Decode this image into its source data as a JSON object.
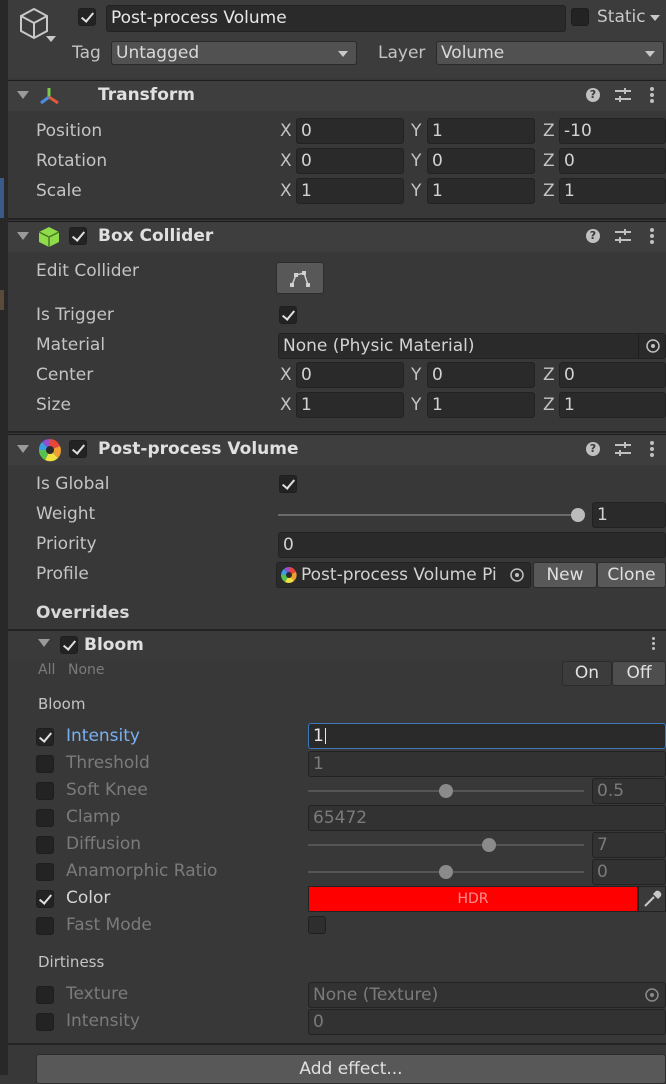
{
  "header": {
    "object_name": "Post-process Volume",
    "static_label": "Static",
    "tag_label": "Tag",
    "tag_value": "Untagged",
    "layer_label": "Layer",
    "layer_value": "Volume",
    "active": true
  },
  "transform": {
    "title": "Transform",
    "rows": [
      {
        "label": "Position",
        "x": "0",
        "y": "1",
        "z": "-10"
      },
      {
        "label": "Rotation",
        "x": "0",
        "y": "0",
        "z": "0"
      },
      {
        "label": "Scale",
        "x": "1",
        "y": "1",
        "z": "1"
      }
    ]
  },
  "axes": {
    "x": "X",
    "y": "Y",
    "z": "Z"
  },
  "box_collider": {
    "title": "Box Collider",
    "edit_collider_label": "Edit Collider",
    "is_trigger_label": "Is Trigger",
    "is_trigger": true,
    "material_label": "Material",
    "material_value": "None (Physic Material)",
    "center": {
      "label": "Center",
      "x": "0",
      "y": "0",
      "z": "0"
    },
    "size": {
      "label": "Size",
      "x": "1",
      "y": "1",
      "z": "1"
    }
  },
  "ppv": {
    "title": "Post-process Volume",
    "is_global_label": "Is Global",
    "is_global": true,
    "weight_label": "Weight",
    "weight_value": "1",
    "weight_fraction": 1.0,
    "priority_label": "Priority",
    "priority_value": "0",
    "profile_label": "Profile",
    "profile_value": "Post-process Volume Pi",
    "new_label": "New",
    "clone_label": "Clone",
    "overrides_label": "Overrides"
  },
  "bloom": {
    "title": "Bloom",
    "all_label": "All",
    "none_label": "None",
    "on_label": "On",
    "off_label": "Off",
    "section_bloom": "Bloom",
    "intensity_label": "Intensity",
    "intensity_value": "1",
    "threshold_label": "Threshold",
    "threshold_value": "1",
    "soft_knee_label": "Soft Knee",
    "soft_knee_value": "0.5",
    "soft_knee_fraction": 0.5,
    "clamp_label": "Clamp",
    "clamp_value": "65472",
    "diffusion_label": "Diffusion",
    "diffusion_value": "7",
    "diffusion_fraction": 0.655,
    "anamorphic_label": "Anamorphic Ratio",
    "anamorphic_value": "0",
    "anamorphic_fraction": 0.5,
    "color_label": "Color",
    "color_value": "#ff0000",
    "hdr_label": "HDR",
    "fast_mode_label": "Fast Mode",
    "section_dirtiness": "Dirtiness",
    "texture_label": "Texture",
    "texture_value": "None (Texture)",
    "dirt_intensity_label": "Intensity",
    "dirt_intensity_value": "0"
  },
  "add_effect_label": "Add effect...",
  "colors": {
    "accent_blue": "#7bb0f0",
    "panel": "#383838",
    "field": "#2a2a2a",
    "collider_green": "#8fdc4a",
    "bloom_color": "#ff0000"
  }
}
